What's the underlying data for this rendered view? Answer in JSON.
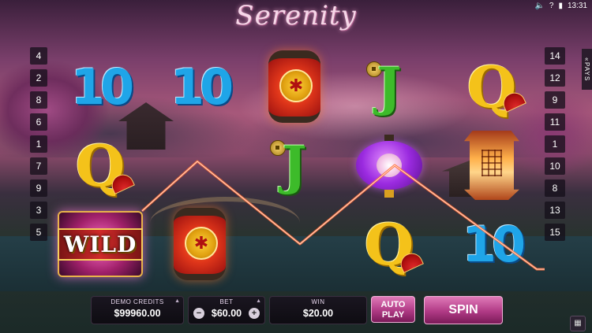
{
  "game": {
    "title": "Serenity",
    "status_bar": {
      "volume_icon": "speaker-icon",
      "help": "?",
      "battery_icon": "battery-icon",
      "time": "13:31"
    }
  },
  "lines": {
    "left": [
      "4",
      "2",
      "8",
      "6",
      "1",
      "7",
      "9",
      "3",
      "5"
    ],
    "right": [
      "14",
      "12",
      "9",
      "11",
      "1",
      "10",
      "8",
      "13",
      "15"
    ],
    "pays_label": "PAYS",
    "pays_arrow": "«"
  },
  "reels": [
    [
      "10",
      "Q",
      "WILD"
    ],
    [
      "10",
      "J",
      "red-lantern"
    ],
    [
      "red-lantern",
      "J",
      "purple-lantern"
    ],
    [
      "J",
      "purple-lantern",
      "Q"
    ],
    [
      "Q",
      "tower-lantern",
      "10"
    ]
  ],
  "symbols_text": {
    "ten": "10",
    "queen": "Q",
    "jack": "J",
    "wild": "WILD"
  },
  "controls": {
    "credits": {
      "label": "DEMO CREDITS",
      "value": "$99960.00"
    },
    "bet": {
      "label": "BET",
      "value": "$60.00",
      "minus": "−",
      "plus": "+"
    },
    "win": {
      "label": "WIN",
      "value": "$20.00"
    },
    "autoplay_line1": "AUTO",
    "autoplay_line2": "PLAY",
    "spin": "SPIN"
  },
  "colors": {
    "accent_pink": "#b03a85",
    "winline": "#ff6a3a"
  }
}
